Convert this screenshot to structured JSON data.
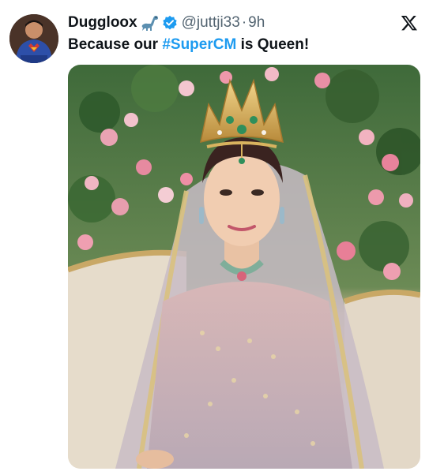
{
  "post": {
    "author": {
      "display_name": "Duggloox",
      "handle": "@juttji33",
      "badge_icons": [
        "dinosaur-emoji-icon",
        "verified-badge-icon"
      ]
    },
    "separator": "·",
    "timestamp": "9h",
    "text": {
      "prefix": "Because our ",
      "hashtag": "#SuperCM",
      "suffix": " is Queen!"
    },
    "media": {
      "kind": "photo",
      "alt": ""
    },
    "platform_icon": "x-logo-icon"
  },
  "colors": {
    "text": "#0f1419",
    "secondary": "#536471",
    "link": "#1d9bf0",
    "verified": "#1d9bf0"
  }
}
